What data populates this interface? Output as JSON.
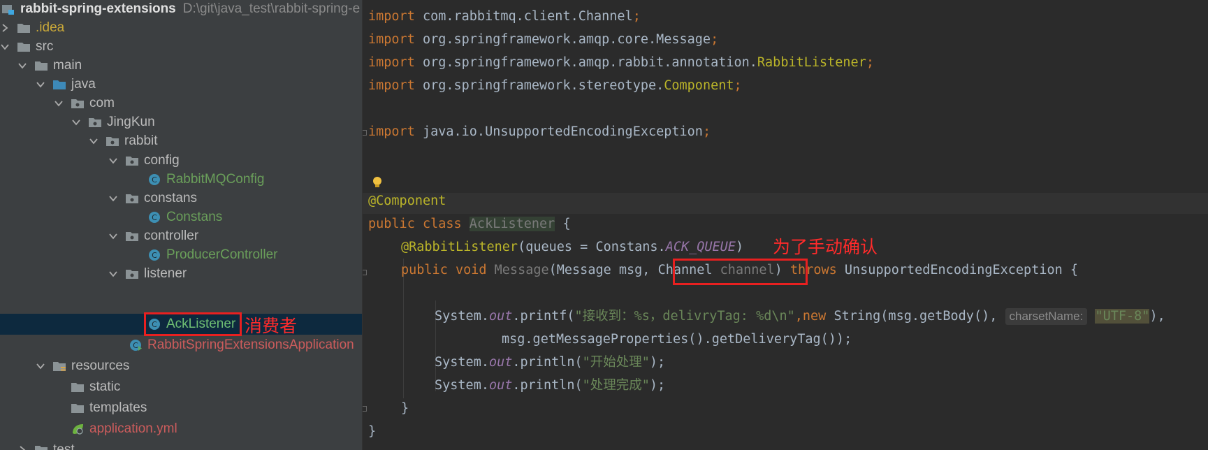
{
  "project": {
    "root_name": "rabbit-spring-extensions",
    "root_path": "D:\\git\\java_test\\rabbit-spring-e",
    "items": [
      {
        "label": "rabbit-spring-extensions"
      },
      {
        "label": ".idea"
      },
      {
        "label": "src"
      },
      {
        "label": "main"
      },
      {
        "label": "java"
      },
      {
        "label": "com"
      },
      {
        "label": "JingKun"
      },
      {
        "label": "rabbit"
      },
      {
        "label": "config"
      },
      {
        "label": "RabbitMQConfig"
      },
      {
        "label": "constans"
      },
      {
        "label": "Constans"
      },
      {
        "label": "controller"
      },
      {
        "label": "ProducerController"
      },
      {
        "label": "listener"
      },
      {
        "label": "AckListener"
      },
      {
        "label": "RabbitSpringExtensionsApplication"
      },
      {
        "label": "resources"
      },
      {
        "label": "static"
      },
      {
        "label": "templates"
      },
      {
        "label": "application.yml"
      },
      {
        "label": "test"
      }
    ]
  },
  "annotations": {
    "consumer_note": "消费者",
    "manual_ack_note": "为了手动确认"
  },
  "code": {
    "l1_kw": "import",
    "l1_rest": " com.rabbitmq.client.Channel",
    "l2_kw": "import",
    "l2_rest": " org.springframework.amqp.core.Message",
    "l3_kw": "import",
    "l3_rest": " org.springframework.amqp.rabbit.annotation.",
    "l3_cls": "RabbitListener",
    "l4_kw": "import",
    "l4_rest": " org.springframework.stereotype.",
    "l4_cls": "Component",
    "l5_kw": "import",
    "l5_rest": " java.io.UnsupportedEncodingException",
    "semi": ";",
    "l6_ann": "@Component",
    "l7_kw": "public class ",
    "l7_cls": "AckListener",
    "l7_rest": " {",
    "l8_ann": "@RabbitListener",
    "l8_rest": "(queues = Constans.",
    "l8_const": "ACK_QUEUE",
    "l8_close": ")",
    "l9_kw": "public void ",
    "l9_method": "Message",
    "l9_a": "(Message msg, ",
    "l9_param_type": "Channel ",
    "l9_param_name": "channel",
    "l9_b": ") ",
    "l9_throws": "throws",
    "l9_c": " UnsupportedEncodingException {",
    "l10_a": "System.",
    "l10_out": "out",
    "l10_b": ".printf(",
    "l10_str": "\"接收到：%s，delivryTag: %d\\n\"",
    "l10_c": ",",
    "l10_new": "new",
    "l10_d": " String(msg.getBody(),",
    "l10_inlay": "charsetName:",
    "l10_str2": "\"UTF-8\"",
    "l10_e": "),",
    "l11": "msg.getMessageProperties().getDeliveryTag());",
    "l12_a": "System.",
    "l12_out": "out",
    "l12_b": ".println(",
    "l12_str": "\"开始处理\"",
    "l12_c": ");",
    "l13_a": "System.",
    "l13_out": "out",
    "l13_b": ".println(",
    "l13_str": "\"处理完成\"",
    "l13_c": ");",
    "l14": "}",
    "l15": "}"
  }
}
